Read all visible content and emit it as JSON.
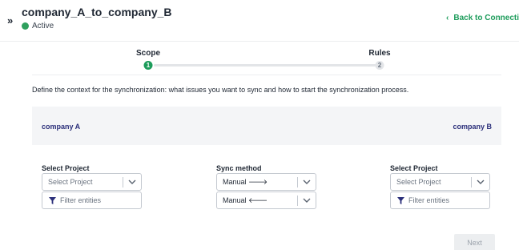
{
  "header": {
    "title": "company_A_to_company_B",
    "status": "Active",
    "back_link": "Back to Connections",
    "colors": {
      "status": "#2fa05e",
      "accent": "#1d9c5b"
    }
  },
  "steps": [
    {
      "label": "Scope",
      "number": "1",
      "state": "active"
    },
    {
      "label": "Rules",
      "number": "2",
      "state": "inactive"
    }
  ],
  "description": "Define the context for the synchronization: what issues you want to sync and how to start the synchronization process.",
  "companies": {
    "left": "company A",
    "right": "company B"
  },
  "left_panel": {
    "label": "Select Project",
    "select_placeholder": "Select Project",
    "filter_placeholder": "Filter entities"
  },
  "sync_panel": {
    "label": "Sync method",
    "outgoing": "Manual",
    "outgoing_icon": "arrow-right-icon",
    "incoming": "Manual",
    "incoming_icon": "arrow-left-icon"
  },
  "right_panel": {
    "label": "Select Project",
    "select_placeholder": "Select Project",
    "filter_placeholder": "Filter entities"
  },
  "footer": {
    "next_label": "Next"
  }
}
